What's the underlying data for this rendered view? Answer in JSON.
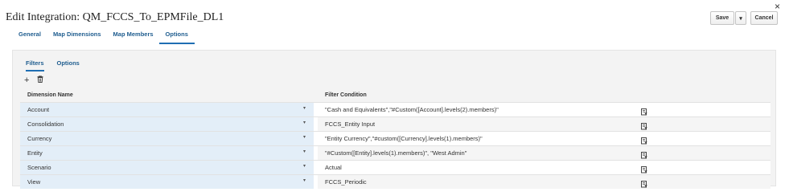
{
  "page": {
    "title": "Edit Integration: QM_FCCS_To_EPMFile_DL1",
    "close_glyph": "×"
  },
  "actions": {
    "save_label": "Save",
    "menu_glyph": "▾",
    "cancel_label": "Cancel"
  },
  "tabs": [
    {
      "label": "General",
      "active": false
    },
    {
      "label": "Map Dimensions",
      "active": false
    },
    {
      "label": "Map Members",
      "active": false
    },
    {
      "label": "Options",
      "active": true
    }
  ],
  "subtabs": [
    {
      "label": "Filters",
      "active": true
    },
    {
      "label": "Options",
      "active": false
    }
  ],
  "toolbar": {
    "add_glyph": "+",
    "delete_icon": "trash-icon"
  },
  "table": {
    "headers": {
      "dimension": "Dimension Name",
      "condition": "Filter Condition"
    },
    "dropdown_glyph": "▾",
    "filter_icon": "filter-edit-icon",
    "rows": [
      {
        "dimension": "Account",
        "condition": "\"Cash and Equivalents\",\"#Custom([Account].levels(2).members)\""
      },
      {
        "dimension": "Consolidation",
        "condition": "FCCS_Entity Input"
      },
      {
        "dimension": "Currency",
        "condition": "\"Entity Currency\",\"#custom([Currency].levels(1).members)\""
      },
      {
        "dimension": "Entity",
        "condition": "\"#Custom([Entity].levels(1).members)\", \"West Admin\""
      },
      {
        "dimension": "Scenario",
        "condition": "Actual"
      },
      {
        "dimension": "View",
        "condition": "FCCS_Periodic"
      }
    ]
  },
  "colors": {
    "accent": "#1f6eb3",
    "link": "#1f5d8f",
    "dimension_cell": "#e3eef8",
    "panel": "#f3f3f3"
  }
}
